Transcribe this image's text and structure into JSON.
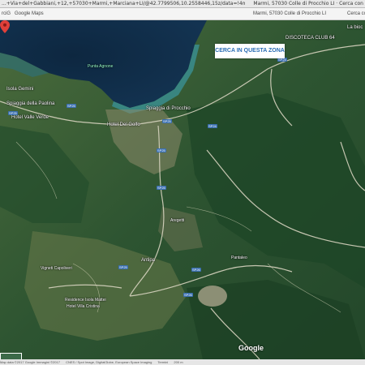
{
  "browser": {
    "address": "...+Via+del+Gabbiani,+12,+57030+Marmi,+Marciana+LI/@42.7799506,10.2558446,15z/data=!4m5!3m4!1s0x12d5417b1c6dd...",
    "right_title": "Marmi, 57030 Colle di Procchio LI · Cerca con",
    "tab1": "rciG",
    "tab2": "Google Maps",
    "tab3": "Marmi, 57030 Colle di Procchio LI",
    "tab4": "Cerca con"
  },
  "map": {
    "search_here_label": "CERCA IN QUESTA ZONA",
    "google_logo": "Google",
    "labels": {
      "isola_gemini": "Isola Gemini",
      "spiaggia_paolina": "Spiaggia della Paolina",
      "hotel_valle_verde": "Hotel Valle Verde",
      "punta_agnone": "Punta Agnone",
      "spiaggia_procchio": "Spiaggia di Procchio",
      "hotel_del_golfo": "Hotel Del Golfo",
      "discoteca": "DISCOTECA CLUB 64",
      "la_bioc": "La bioc",
      "aregetti": "Aregetti",
      "antipa": "Antipa",
      "vigneti": "Vigneti Capoliveri",
      "residence": "Residence Isola Mattei",
      "hotel_villa": "Hotel Villa Cristina",
      "pantaleo": "Pantaleo"
    },
    "road_badges": [
      "SP25",
      "SP25",
      "SP25",
      "SP25",
      "SP25",
      "SP25",
      "SP24",
      "SP24",
      "SP26",
      "SP26"
    ]
  },
  "footer": {
    "items": [
      "Map data ©2017 Google Immagini ©2017",
      "CNES / Spot Image, DigitalGlobe, European Space Imaging",
      "Termini",
      "200 m"
    ]
  },
  "colors": {
    "sea": "#0f2a44",
    "shallow": "#3b8c8f",
    "forest": "#2f5a33",
    "accent": "#2a6db5"
  }
}
